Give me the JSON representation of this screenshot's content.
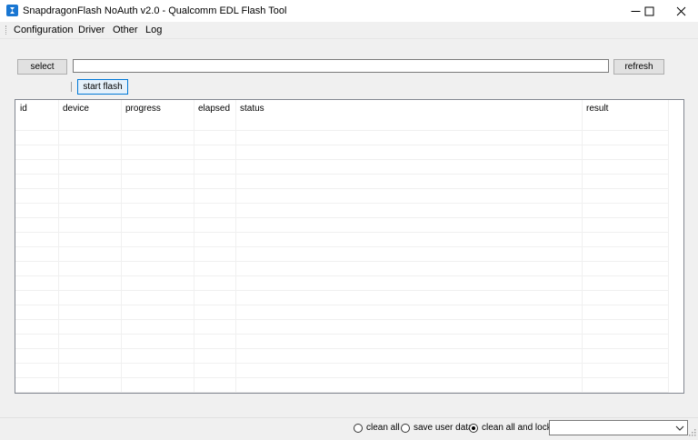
{
  "window": {
    "title": "SnapdragonFlash NoAuth v2.0 - Qualcomm EDL Flash Tool",
    "icon": "snapdragon-app-icon"
  },
  "menu": {
    "items": [
      {
        "label": "Configuration"
      },
      {
        "label": "Driver"
      },
      {
        "label": "Other"
      },
      {
        "label": "Log"
      }
    ]
  },
  "toolbar": {
    "select_label": "select",
    "path_value": "",
    "refresh_label": "refresh",
    "start_flash_label": "start flash"
  },
  "grid": {
    "columns": [
      {
        "label": "id"
      },
      {
        "label": "device"
      },
      {
        "label": "progress"
      },
      {
        "label": "elapsed"
      },
      {
        "label": "status"
      },
      {
        "label": "result"
      }
    ],
    "rows": []
  },
  "footer": {
    "options": [
      {
        "label": "clean all",
        "selected": false
      },
      {
        "label": "save user data",
        "selected": false
      },
      {
        "label": "clean all and lock",
        "selected": true
      }
    ],
    "combo_value": ""
  },
  "colors": {
    "accent": "#0078d7",
    "app_icon": "#1976d2"
  }
}
